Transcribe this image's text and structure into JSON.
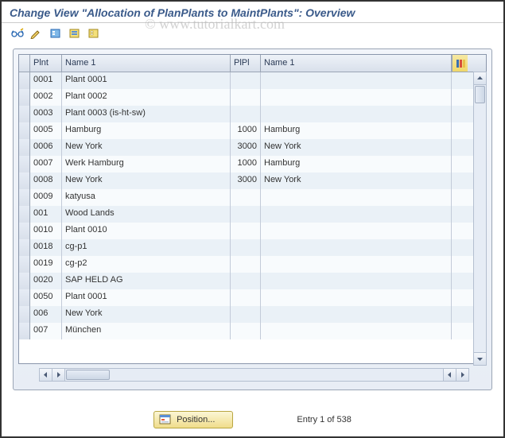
{
  "title": "Change View \"Allocation of PlanPlants to MaintPlants\": Overview",
  "watermark": "© www.tutorialkart.com",
  "toolbar": {
    "icons": [
      "display-change",
      "change",
      "select-all",
      "select-block",
      "deselect-all"
    ]
  },
  "columns": {
    "plnt": "Plnt",
    "name1a": "Name 1",
    "plpl": "PlPl",
    "name1b": "Name 1"
  },
  "rows": [
    {
      "plnt": "0001",
      "name1": "Plant 0001",
      "plpl": "",
      "name2": ""
    },
    {
      "plnt": "0002",
      "name1": "Plant 0002",
      "plpl": "",
      "name2": ""
    },
    {
      "plnt": "0003",
      "name1": "Plant 0003 (is-ht-sw)",
      "plpl": "",
      "name2": ""
    },
    {
      "plnt": "0005",
      "name1": "Hamburg",
      "plpl": "1000",
      "name2": "Hamburg"
    },
    {
      "plnt": "0006",
      "name1": "New York",
      "plpl": "3000",
      "name2": "New York"
    },
    {
      "plnt": "0007",
      "name1": "Werk Hamburg",
      "plpl": "1000",
      "name2": "Hamburg"
    },
    {
      "plnt": "0008",
      "name1": "New York",
      "plpl": "3000",
      "name2": "New York"
    },
    {
      "plnt": "0009",
      "name1": "katyusa",
      "plpl": "",
      "name2": ""
    },
    {
      "plnt": "001",
      "name1": "Wood Lands",
      "plpl": "",
      "name2": ""
    },
    {
      "plnt": "0010",
      "name1": "Plant 0010",
      "plpl": "",
      "name2": ""
    },
    {
      "plnt": "0018",
      "name1": "cg-p1",
      "plpl": "",
      "name2": ""
    },
    {
      "plnt": "0019",
      "name1": "cg-p2",
      "plpl": "",
      "name2": ""
    },
    {
      "plnt": "0020",
      "name1": "SAP HELD AG",
      "plpl": "",
      "name2": ""
    },
    {
      "plnt": "0050",
      "name1": "Plant 0001",
      "plpl": "",
      "name2": ""
    },
    {
      "plnt": "006",
      "name1": "New York",
      "plpl": "",
      "name2": ""
    },
    {
      "plnt": "007",
      "name1": "München",
      "plpl": "",
      "name2": ""
    }
  ],
  "footer": {
    "position_label": "Position...",
    "entry_text": "Entry 1 of 538"
  }
}
